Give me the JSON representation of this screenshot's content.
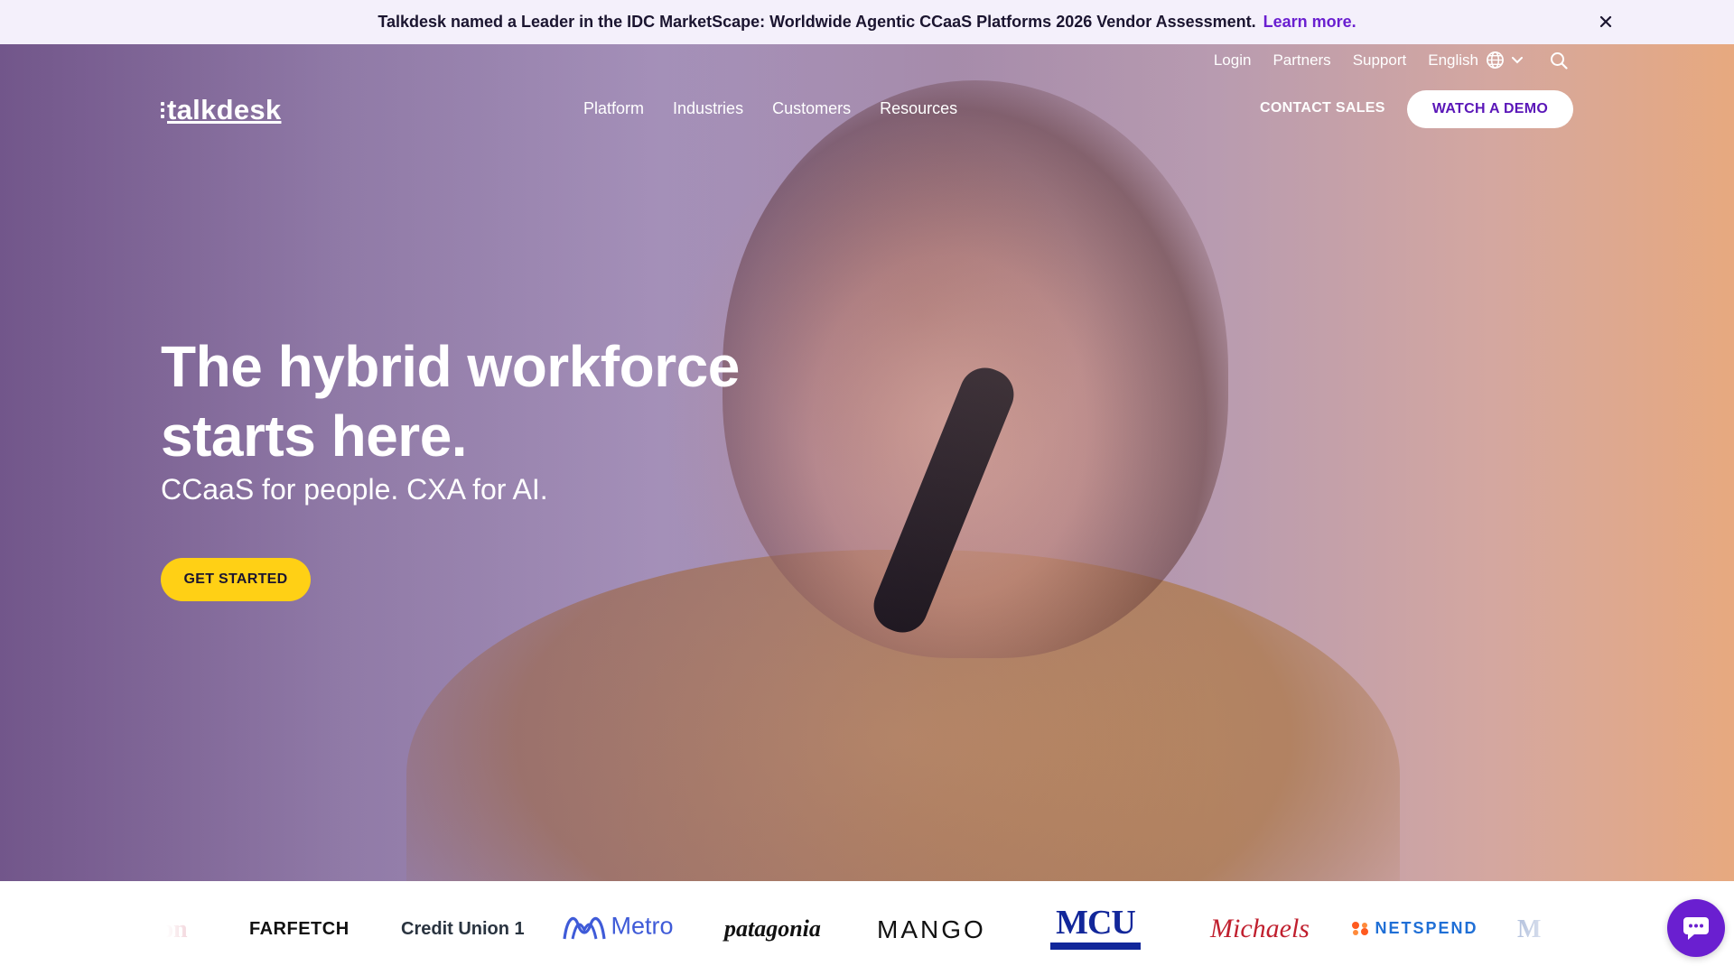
{
  "announcement": {
    "message": "Talkdesk named a Leader in the IDC MarketScape: Worldwide Agentic CCaaS Platforms 2026 Vendor Assessment.",
    "link_text": "Learn more.",
    "close_icon": "close-icon"
  },
  "utility_nav": {
    "items": [
      "Login",
      "Partners",
      "Support"
    ],
    "language": "English",
    "language_icon": "globe-icon",
    "dropdown_icon": "chevron-down-icon",
    "search_icon": "search-icon"
  },
  "brand": {
    "logo_text": "talkdesk"
  },
  "main_nav": {
    "items": [
      "Platform",
      "Industries",
      "Customers",
      "Resources"
    ],
    "contact_sales": "CONTACT SALES",
    "watch_demo": "WATCH A DEMO"
  },
  "hero": {
    "headline_line1": "The hybrid workforce",
    "headline_line2": "starts here.",
    "subheadline": "CCaaS for people. CXA for AI.",
    "cta": "GET STARTED"
  },
  "customer_logos": [
    "FARFETCH",
    "Credit Union 1",
    "Metro",
    "patagonia",
    "MANGO",
    "MCU",
    "Michaels",
    "NETSPEND"
  ],
  "colors": {
    "accent_purple": "#6a1fd0",
    "cta_yellow": "#ffd015",
    "announcement_bg": "#f4f0fb"
  },
  "chat": {
    "icon": "chat-bubble-icon"
  }
}
